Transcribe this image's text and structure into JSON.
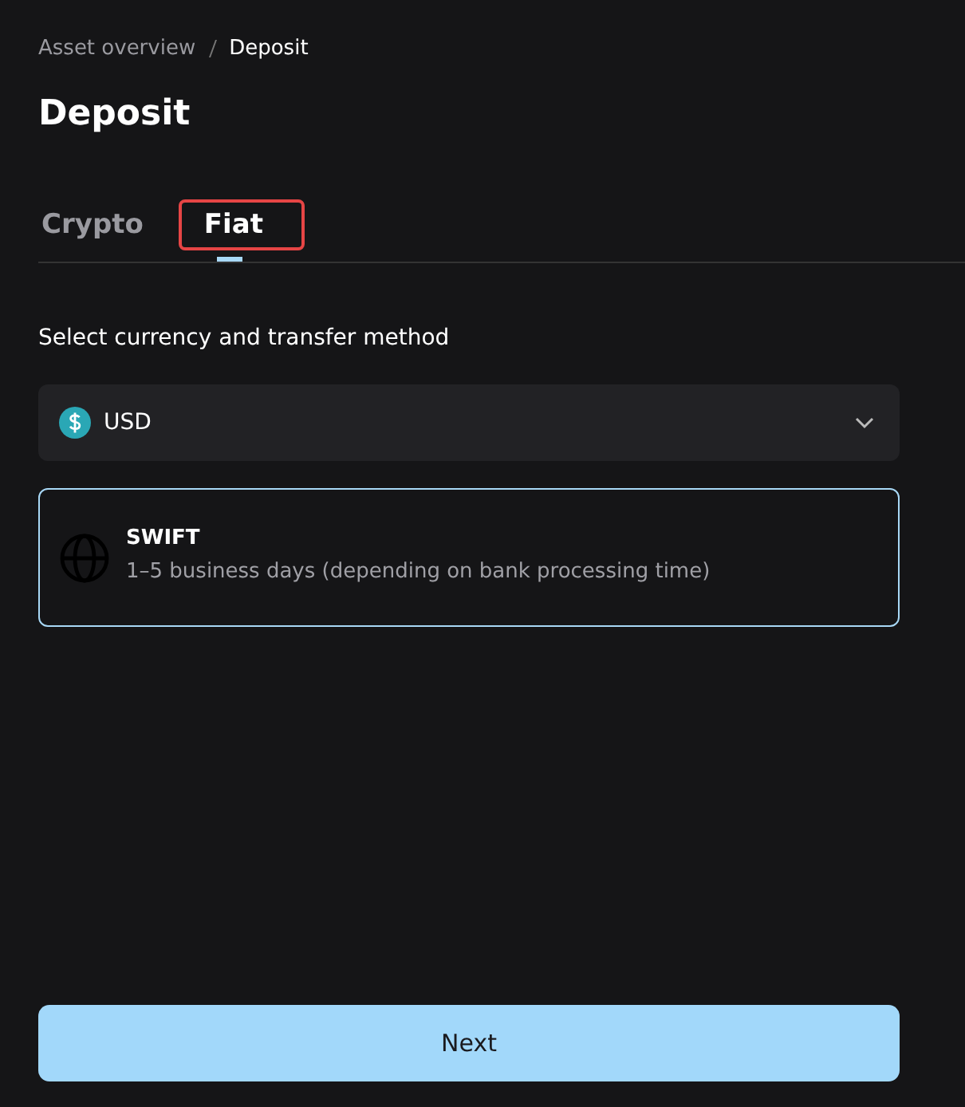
{
  "breadcrumb": [
    {
      "label": "Asset overview",
      "current": false
    },
    {
      "label": "Deposit",
      "current": true
    }
  ],
  "title": "Deposit",
  "tabs": [
    {
      "label": "Crypto",
      "selected": false,
      "highlighted": false
    },
    {
      "label": "Fiat",
      "selected": true,
      "highlighted": true
    }
  ],
  "section_label": "Select currency and transfer method",
  "currency": {
    "value": "USD"
  },
  "methods": [
    {
      "name": "SWIFT",
      "description": "1–5 business days (depending on bank processing time)",
      "selected": true
    }
  ],
  "button": "Next"
}
